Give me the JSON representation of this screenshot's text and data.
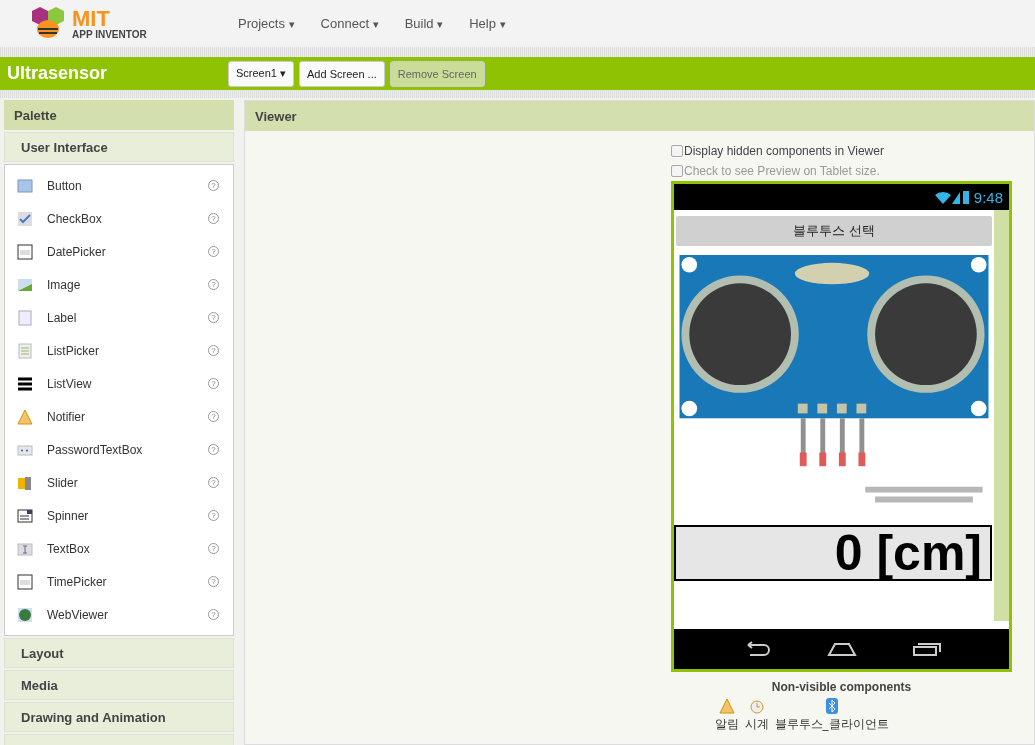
{
  "logo": {
    "title": "MIT",
    "subtitle": "APP INVENTOR"
  },
  "menu": [
    {
      "label": "Projects",
      "caret": "▾"
    },
    {
      "label": "Connect",
      "caret": "▾"
    },
    {
      "label": "Build",
      "caret": "▾"
    },
    {
      "label": "Help",
      "caret": "▾"
    }
  ],
  "project": {
    "title": "Ultrasensor"
  },
  "screen_buttons": [
    {
      "label": "Screen1 ▾",
      "disabled": false
    },
    {
      "label": "Add Screen ...",
      "disabled": false
    },
    {
      "label": "Remove Screen",
      "disabled": true
    }
  ],
  "palette": {
    "title": "Palette",
    "section": "User Interface",
    "help": "?",
    "items": [
      {
        "label": "Button"
      },
      {
        "label": "CheckBox"
      },
      {
        "label": "DatePicker"
      },
      {
        "label": "Image"
      },
      {
        "label": "Label"
      },
      {
        "label": "ListPicker"
      },
      {
        "label": "ListView"
      },
      {
        "label": "Notifier"
      },
      {
        "label": "PasswordTextBox"
      },
      {
        "label": "Slider"
      },
      {
        "label": "Spinner"
      },
      {
        "label": "TextBox"
      },
      {
        "label": "TimePicker"
      },
      {
        "label": "WebViewer"
      }
    ],
    "sections": [
      {
        "label": "Layout"
      },
      {
        "label": "Media"
      },
      {
        "label": "Drawing and Animation"
      }
    ]
  },
  "viewer": {
    "title": "Viewer",
    "options": [
      {
        "label": "Display hidden components in Viewer",
        "checked": false,
        "disabled": false
      },
      {
        "label": "Check to see Preview on Tablet size.",
        "checked": false,
        "disabled": true
      }
    ],
    "phone": {
      "time": "9:48",
      "button": "블루투스 선택",
      "reading": "0 [cm]"
    },
    "nonvisible_title": "Non-visible components",
    "nonvisible": [
      {
        "label": "알림"
      },
      {
        "label": "시계"
      },
      {
        "label": "블루투스_클라이언트"
      }
    ]
  }
}
